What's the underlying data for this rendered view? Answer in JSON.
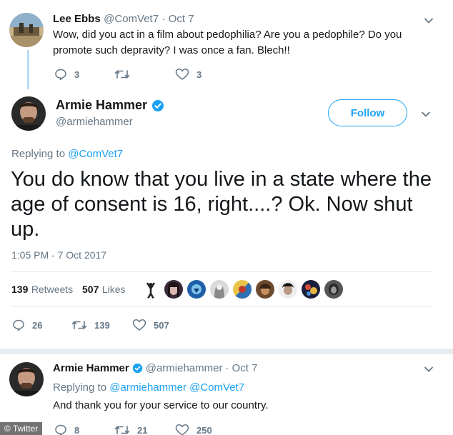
{
  "reply1": {
    "name": "Lee Ebbs",
    "handle": "@ComVet7",
    "time": "· Oct 7",
    "text": "Wow, did you act in a film about pedophilia? Are you a pedophile? Do you promote such depravity? I was once a fan. Blech!!",
    "replies": "3",
    "retweets": "",
    "likes": "3"
  },
  "main": {
    "name": "Armie Hammer",
    "handle": "@armiehammer",
    "follow_label": "Follow",
    "replying_prefix": "Replying to",
    "replying_to": "@ComVet7",
    "text": "You do know that you live in a state where the age of consent is 16, right....? Ok. Now shut up.",
    "timestamp": "1:05 PM - 7 Oct 2017",
    "retweets_count": "139",
    "retweets_label": "Retweets",
    "likes_count": "507",
    "likes_label": "Likes",
    "action_replies": "26",
    "action_retweets": "139",
    "action_likes": "507"
  },
  "reply2": {
    "name": "Armie Hammer",
    "handle": "@armiehammer",
    "time": "· Oct 7",
    "replying_prefix": "Replying to",
    "replying_to": "@armiehammer @ComVet7",
    "text": "And thank you for your service to our country.",
    "replies": "8",
    "retweets": "21",
    "likes": "250"
  },
  "watermark": "© Twitter",
  "colors": {
    "accent": "#1da1f2",
    "text": "#14171a",
    "muted": "#657786",
    "divider": "#e6ecf0",
    "thread": "#b8dcf6"
  }
}
